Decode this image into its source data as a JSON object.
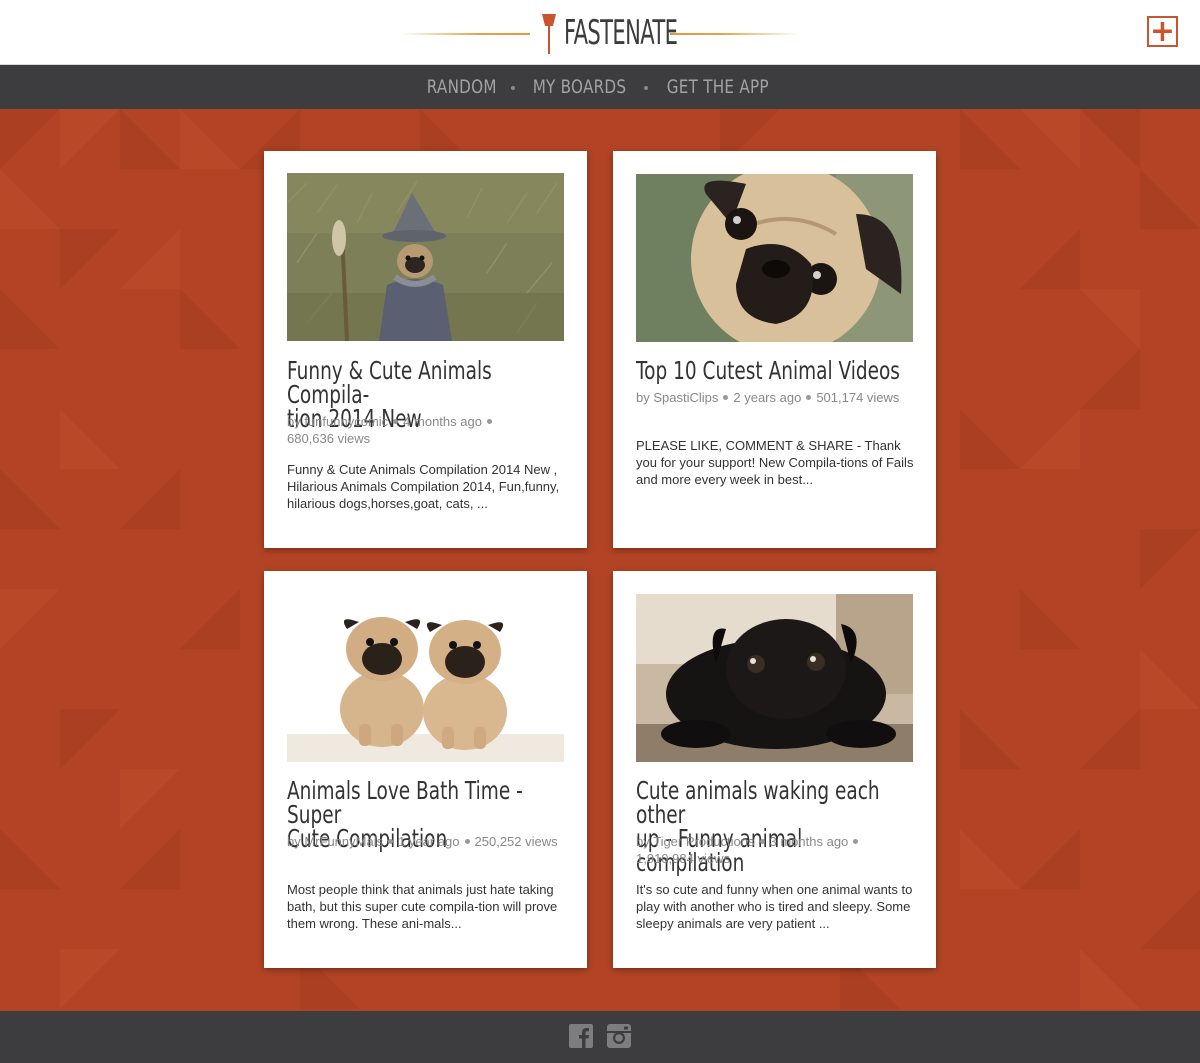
{
  "brand": {
    "name": "FASTENATE",
    "accent": "#c9552f",
    "line": "#e6a24a"
  },
  "header": {
    "add_label": "+"
  },
  "nav": {
    "items": [
      {
        "label": "RANDOM"
      },
      {
        "label": "MY BOARDS"
      },
      {
        "label": "GET THE APP"
      }
    ]
  },
  "cards": [
    {
      "title": "Funny & Cute Animals Compila-tion 2014 New",
      "title_lines": [
        "Funny & Cute Animals Compila-",
        "tion 2014 New"
      ],
      "author": "by funfunnycomic",
      "age": "4 months ago",
      "views": "680,636 views",
      "description": "Funny & Cute Animals Compilation 2014 New , Hilarious Animals Compilation 2014, Fun,funny, hilarious dogs,horses,goat, cats, ..."
    },
    {
      "title": "Top 10 Cutest Animal Videos",
      "title_lines": [
        "Top 10 Cutest Animal Videos"
      ],
      "author": "by SpastiClips",
      "age": "2 years ago",
      "views": "501,174 views",
      "description": "PLEASE LIKE, COMMENT & SHARE - Thank you for your support! New Compila-tions of Fails and more every week in best..."
    },
    {
      "title": "Animals Love Bath Time - Super Cute Compilation",
      "title_lines": [
        "Animals Love Bath Time - Super",
        "Cute Compilation"
      ],
      "author": "by MrFunnyMals",
      "age": "1 year ago",
      "views": "250,252 views",
      "description": "Most people think that animals just hate taking bath, but this super cute compila-tion will prove them wrong. These ani-mals..."
    },
    {
      "title": "Cute animals waking each other up - Funny animal compilation",
      "title_lines": [
        "Cute animals waking each other",
        "up - Funny animal compilation"
      ],
      "author": "by Tiger Productions",
      "age": "3 months ago",
      "views": "1,910,984 views",
      "description": "It's so cute and funny when one animal wants to play with another who is tired and sleepy. Some sleepy animals are very patient ..."
    }
  ],
  "footer": {
    "icons": [
      "facebook-icon",
      "instagram-icon"
    ]
  }
}
